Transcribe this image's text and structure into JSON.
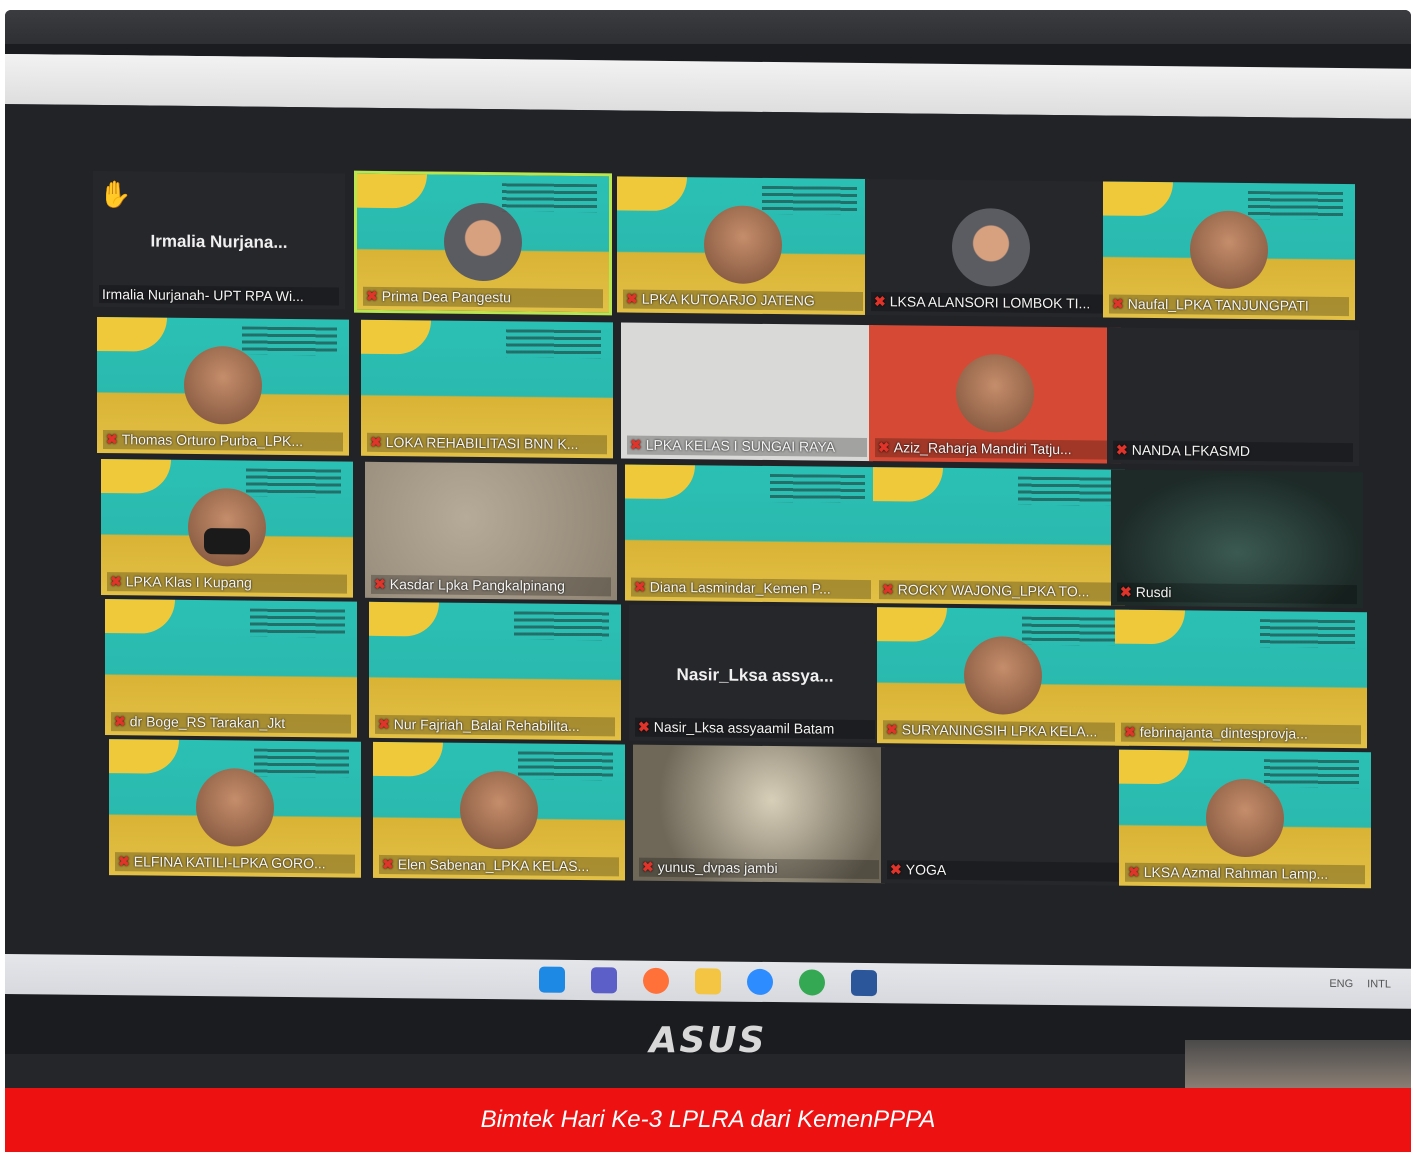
{
  "caption": "Bimtek Hari Ke-3 LPLRA dari KemenPPPA",
  "monitor_brand": "ASUS",
  "participants": [
    {
      "name": "Irmalia Nurjanah- UPT RPA Wi...",
      "center": "Irmalia Nurjana...",
      "style": "dark",
      "hand_raised": true
    },
    {
      "name": "Prima Dea Pangestu",
      "style": "teal",
      "active": true,
      "person": "hijab"
    },
    {
      "name": "LPKA KUTOARJO JATENG",
      "style": "teal",
      "person": "plain"
    },
    {
      "name": "LKSA ALANSORI LOMBOK TI...",
      "style": "dark",
      "person": "hijab"
    },
    {
      "name": "Naufal_LPKA TANJUNGPATI",
      "style": "teal",
      "person": "plain"
    },
    {
      "name": "Thomas Orturo Purba_LPK...",
      "style": "teal",
      "person": "plain"
    },
    {
      "name": "LOKA REHABILITASI BNN K...",
      "style": "teal"
    },
    {
      "name": "LPKA KELAS I SUNGAI RAYA",
      "style": "gray"
    },
    {
      "name": "Aziz_Raharja Mandiri Tatju...",
      "style": "portrait",
      "person": "plain"
    },
    {
      "name": "NANDA LFKASMD",
      "style": "dark"
    },
    {
      "name": "LPKA Klas I Kupang",
      "style": "teal",
      "person": "mask"
    },
    {
      "name": "Kasdar Lpka Pangkalpinang",
      "style": "pattern"
    },
    {
      "name": "Diana Lasmindar_Kemen P...",
      "style": "teal"
    },
    {
      "name": "ROCKY WAJONG_LPKA TO...",
      "style": "teal"
    },
    {
      "name": "Rusdi",
      "style": "forest"
    },
    {
      "name": "dr Boge_RS Tarakan_Jkt",
      "style": "teal"
    },
    {
      "name": "Nur Fajriah_Balai Rehabilita...",
      "style": "teal"
    },
    {
      "name": "Nasir_Lksa assyaamil Batam",
      "center": "Nasir_Lksa assya...",
      "style": "dark"
    },
    {
      "name": "SURYANINGSIH LPKA KELA...",
      "style": "teal",
      "person": "plain"
    },
    {
      "name": "febrinajanta_dintesprovja...",
      "style": "teal"
    },
    {
      "name": "ELFINA KATILI-LPKA GORO...",
      "style": "teal",
      "person": "plain"
    },
    {
      "name": "Elen Sabenan_LPKA KELAS...",
      "style": "teal",
      "person": "plain"
    },
    {
      "name": "yunus_dvpas jambi",
      "style": "lamp"
    },
    {
      "name": "YOGA",
      "style": "dark"
    },
    {
      "name": "LKSA Azmal Rahman Lamp...",
      "style": "teal",
      "person": "plain"
    }
  ],
  "taskbar": {
    "icons": [
      "windows-start-icon",
      "chat-icon",
      "firefox-icon",
      "file-explorer-icon",
      "zoom-icon",
      "chrome-icon",
      "word-icon"
    ],
    "tray_lang": "ENG",
    "tray_sub": "INTL"
  }
}
